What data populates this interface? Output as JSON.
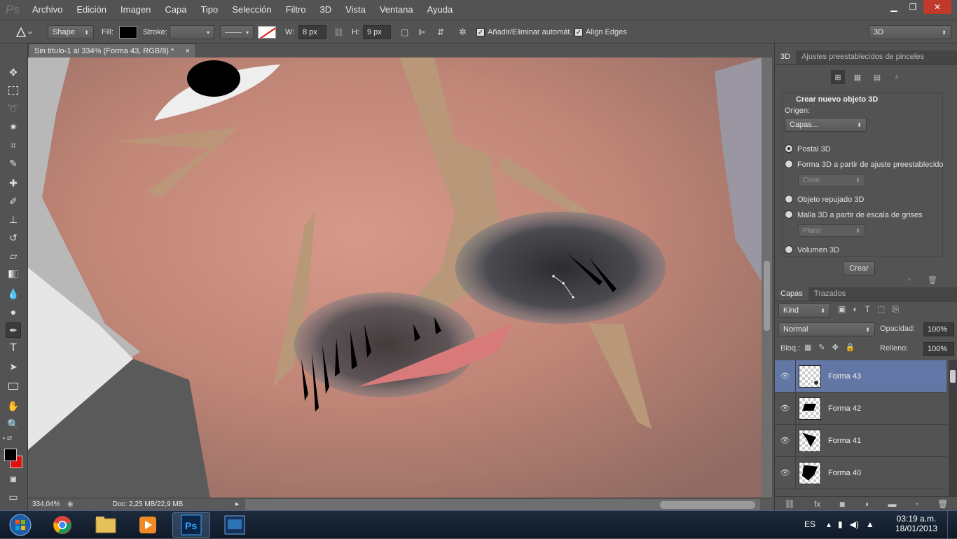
{
  "app": {
    "logo": "Ps"
  },
  "menu": [
    "Archivo",
    "Edición",
    "Imagen",
    "Capa",
    "Tipo",
    "Selección",
    "Filtro",
    "3D",
    "Vista",
    "Ventana",
    "Ayuda"
  ],
  "window_controls": {
    "minimize": "▁",
    "restore": "❐",
    "close": "✕"
  },
  "options": {
    "mode": "Shape",
    "fill_label": "Fill:",
    "stroke_label": "Stroke:",
    "w_label": "W:",
    "w_value": "8 px",
    "h_label": "H:",
    "h_value": "9 px",
    "auto_add_label": "Añadir/Eliminar automát.",
    "align_edges_label": "Align Edges",
    "workspace": "3D"
  },
  "document": {
    "tab_title": "Sin título-1 al 334% (Forma 43, RGB/8) *",
    "tab_close": "×",
    "zoom": "334,04%",
    "doc_info": "Doc: 2,25 MB/22,9 MB"
  },
  "panel_3d": {
    "tabs": [
      "3D",
      "Ajustes preestablecidos de pinceles"
    ],
    "section_title": "Crear nuevo objeto 3D",
    "origin_label": "Origen:",
    "origin_value": "Capas...",
    "options": [
      {
        "label": "Postal 3D",
        "selected": true
      },
      {
        "label": "Forma 3D a partir de ajuste preestablecido",
        "selected": false
      },
      {
        "label": "Objeto repujado 3D",
        "selected": false
      },
      {
        "label": "Malla 3D a partir de escala de grises",
        "selected": false
      },
      {
        "label": "Volumen 3D",
        "selected": false
      }
    ],
    "shape_preset": "Cono",
    "mesh_preset": "Plano",
    "create_button": "Crear"
  },
  "layers_panel": {
    "tabs": [
      "Capas",
      "Trazados"
    ],
    "filter": "Kind",
    "blend_mode": "Normal",
    "opacity_label": "Opacidad:",
    "opacity_value": "100%",
    "lock_label": "Bloq.:",
    "fill_label": "Relleno:",
    "fill_value": "100%",
    "layers": [
      {
        "name": "Forma 43",
        "selected": true
      },
      {
        "name": "Forma 42",
        "selected": false
      },
      {
        "name": "Forma 41",
        "selected": false
      },
      {
        "name": "Forma 40",
        "selected": false
      }
    ]
  },
  "taskbar": {
    "lang": "ES",
    "time": "03:19 a.m.",
    "date": "18/01/2013"
  },
  "colors": {
    "accent_selected": "#6277a6",
    "foreground": "#000000",
    "background": "#e01010"
  }
}
